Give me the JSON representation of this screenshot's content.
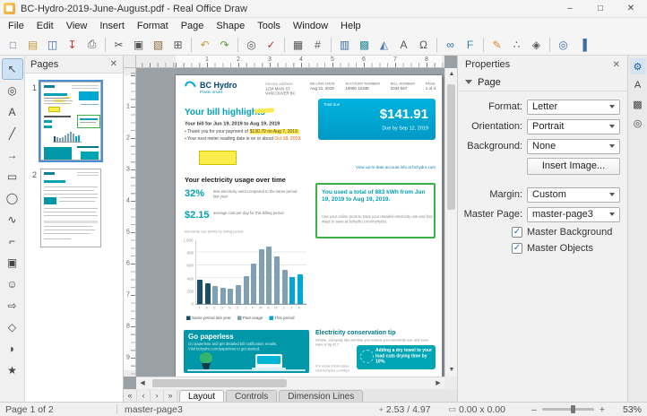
{
  "window": {
    "title": "BC-Hydro-2019-June-August.pdf - Real Office Draw",
    "minimize": "–",
    "maximize": "□",
    "close": "✕"
  },
  "menubar": {
    "items": [
      "File",
      "Edit",
      "View",
      "Insert",
      "Format",
      "Page",
      "Shape",
      "Tools",
      "Window",
      "Help"
    ]
  },
  "toolbar": {
    "items": [
      {
        "name": "new-icon",
        "glyph": "□",
        "color": "#5b7b9c"
      },
      {
        "name": "open-icon",
        "glyph": "▤",
        "color": "#c7973a"
      },
      {
        "name": "save-icon",
        "glyph": "◫",
        "color": "#3a6ea5"
      },
      {
        "name": "export-pdf-icon",
        "glyph": "↧",
        "color": "#c0392b"
      },
      {
        "name": "print-icon",
        "glyph": "⎙",
        "color": "#555555"
      },
      {
        "sep": true
      },
      {
        "name": "cut-icon",
        "glyph": "✂",
        "color": "#555555"
      },
      {
        "name": "copy-icon",
        "glyph": "▣",
        "color": "#555555"
      },
      {
        "name": "paste-icon",
        "glyph": "▧",
        "color": "#8a6d3b"
      },
      {
        "name": "clone-formatting-icon",
        "glyph": "⊞",
        "color": "#555555"
      },
      {
        "sep": true
      },
      {
        "name": "undo-icon",
        "glyph": "↶",
        "color": "#c7a23a"
      },
      {
        "name": "redo-icon",
        "glyph": "↷",
        "color": "#5a9a3a"
      },
      {
        "sep": true
      },
      {
        "name": "find-replace-icon",
        "glyph": "◎",
        "color": "#555555"
      },
      {
        "name": "spelling-icon",
        "glyph": "✓",
        "color": "#c0392b"
      },
      {
        "sep": true
      },
      {
        "name": "display-grid-icon",
        "glyph": "▦",
        "color": "#555555"
      },
      {
        "name": "helplines-icon",
        "glyph": "#",
        "color": "#555555"
      },
      {
        "sep": true
      },
      {
        "name": "insert-table-icon",
        "glyph": "▥",
        "color": "#3a6ea5"
      },
      {
        "name": "insert-image-icon",
        "glyph": "▩",
        "color": "#2e8b9a"
      },
      {
        "name": "insert-chart-icon",
        "glyph": "◭",
        "color": "#4a7fb5"
      },
      {
        "name": "insert-text-box-icon",
        "glyph": "A",
        "color": "#555555"
      },
      {
        "name": "special-character-icon",
        "glyph": "Ω",
        "color": "#555555"
      },
      {
        "sep": true
      },
      {
        "name": "hyperlink-icon",
        "glyph": "∞",
        "color": "#2e6da4"
      },
      {
        "name": "fontwork-icon",
        "glyph": "F",
        "color": "#2e86ab"
      },
      {
        "sep": true
      },
      {
        "name": "show-draw-functions-icon",
        "glyph": "✎",
        "color": "#e08a2e"
      },
      {
        "name": "points-icon",
        "glyph": "∴",
        "color": "#555555"
      },
      {
        "name": "glue-points-icon",
        "glyph": "◈",
        "color": "#555555"
      },
      {
        "sep": true
      },
      {
        "name": "zoom-icon",
        "glyph": "◎",
        "color": "#3a6ea5"
      },
      {
        "name": "sidebar-toggle-icon",
        "glyph": "▐",
        "color": "#3a6ea5"
      }
    ]
  },
  "tools": {
    "items": [
      {
        "name": "select-tool",
        "glyph": "↖",
        "active": true
      },
      {
        "name": "zoom-tool",
        "glyph": "◎"
      },
      {
        "name": "insert-text-box-tool",
        "glyph": "A"
      },
      {
        "name": "insert-line-tool",
        "glyph": "╱"
      },
      {
        "name": "lines-and-arrows-tool",
        "glyph": "→"
      },
      {
        "name": "rectangle-tool",
        "glyph": "▭"
      },
      {
        "name": "ellipse-tool",
        "glyph": "◯"
      },
      {
        "name": "curves-and-polygons-tool",
        "glyph": "∿"
      },
      {
        "name": "connectors-tool",
        "glyph": "⌐"
      },
      {
        "name": "basic-shapes-tool",
        "glyph": "▣"
      },
      {
        "name": "symbol-shapes-tool",
        "glyph": "☺"
      },
      {
        "name": "block-arrows-tool",
        "glyph": "⇨"
      },
      {
        "name": "flowchart-tool",
        "glyph": "◇"
      },
      {
        "name": "callout-shapes-tool",
        "glyph": "◗"
      },
      {
        "name": "stars-and-banners-tool",
        "glyph": "★"
      }
    ]
  },
  "pages_panel": {
    "title": "Pages",
    "close_glyph": "✕",
    "page1_number": "1",
    "page2_number": "2"
  },
  "rulers": {
    "h_numbers": [
      "1",
      "2",
      "3",
      "4",
      "5",
      "6",
      "7",
      "8"
    ],
    "v_numbers": [
      "1",
      "2",
      "3",
      "4",
      "5",
      "6",
      "7",
      "8",
      "9"
    ]
  },
  "scrollbars": {
    "up": "▲",
    "down": "▼",
    "left": "◀",
    "right": "▶"
  },
  "document": {
    "brand": {
      "name": "BC Hydro",
      "tagline": "Power smart"
    },
    "header_info": {
      "address_label": "Service address:",
      "address_line1": "1234 MAIN ST",
      "address_line2": "VANCOUVER BC",
      "cols": [
        {
          "label": "BILLING DATE",
          "value": "Aug 21, 2019"
        },
        {
          "label": "ACCOUNT NUMBER",
          "value": "10000 12345"
        },
        {
          "label": "BILL NUMBER",
          "value": "1034 567"
        },
        {
          "label": "PAGE",
          "value": "1 of 4"
        }
      ]
    },
    "highlights": {
      "title": "Your bill highlights",
      "period_line": "Your bill for Jun 19, 2019 to Aug 19, 2019",
      "bullet1_pre": "• Thank you for your payment of ",
      "bullet1_highlight": "$130.79 on Aug 7, 2019.",
      "bullet2_pre": "• Your next meter reading date is on or about ",
      "bullet2_emphasis": "Oct 18, 2019."
    },
    "total_box": {
      "label": "Total due",
      "amount": "$141.91",
      "due": "Due by Sep 12, 2019"
    },
    "account_link": "View up-to-date account info at bchydro.com",
    "usage": {
      "title": "Your electricity usage over time",
      "stat1_value": "32%",
      "stat1_caption": "less electricity used compared to the same period last year",
      "stat2_value": "$2.15",
      "stat2_caption": "average cost per day for this billing period",
      "note": "Electricity use (kWh) by billing period",
      "summary_title": "You used a total of 883 kWh from Jun 19, 2019 to Aug 19, 2019.",
      "summary_body": "Use your online tools to track your detailed electricity use and find ways to save at bchydro.com/myhydro."
    },
    "paperless": {
      "title": "Go paperless",
      "body1": "Go paperless and get detailed bill notification emails.",
      "body2": "Visit bchydro.com/paperless to get started."
    },
    "tip": {
      "title": "Electricity conservation tip",
      "intro": "Simple, everyday tips will help you reduce your electricity use and save. Here is tip #17:",
      "highlight": "Adding a dry towel to your load cuts drying time by 10%.",
      "footer": "For more information, visit bchydro.com/tips"
    }
  },
  "chart_data": {
    "type": "bar",
    "title": "Your electricity usage over time",
    "categories": [
      "J",
      "A",
      "S",
      "O",
      "N",
      "D",
      "J",
      "F",
      "M",
      "A",
      "M",
      "J",
      "J",
      "A"
    ],
    "values": [
      380,
      330,
      280,
      250,
      240,
      290,
      430,
      640,
      860,
      900,
      740,
      540,
      420,
      463
    ],
    "groups": [
      "last_year",
      "last_year",
      "past",
      "past",
      "past",
      "past",
      "past",
      "past",
      "past",
      "past",
      "past",
      "past",
      "current",
      "current"
    ],
    "palette": {
      "last_year": "#1b4f68",
      "past": "#7fa0b4",
      "current": "#00a6d6"
    },
    "ylabel": "kWh",
    "xlabel": "",
    "ylim": [
      0,
      1000
    ],
    "yticks": [
      "1,000",
      "800",
      "600",
      "400",
      "200",
      "0"
    ],
    "grid": true,
    "legend_position": "bottom",
    "legend": [
      {
        "label": "Same period last year",
        "key": "last_year"
      },
      {
        "label": "Past usage",
        "key": "past"
      },
      {
        "label": "This period",
        "key": "current"
      }
    ]
  },
  "properties": {
    "title": "Properties",
    "close_glyph": "✕",
    "section": "Page",
    "format_label": "Format:",
    "format_value": "Letter",
    "orientation_label": "Orientation:",
    "orientation_value": "Portrait",
    "background_label": "Background:",
    "background_value": "None",
    "insert_image_label": "Insert Image...",
    "margin_label": "Margin:",
    "margin_value": "Custom",
    "master_label": "Master Page:",
    "master_value": "master-page3",
    "check_glyph": "✓",
    "checkbox1": "Master Background",
    "checkbox2": "Master Objects"
  },
  "sidebar_tabs": {
    "items": [
      {
        "name": "properties-tab-icon",
        "glyph": "⚙",
        "active": true
      },
      {
        "name": "styles-tab-icon",
        "glyph": "A"
      },
      {
        "name": "gallery-tab-icon",
        "glyph": "▩"
      },
      {
        "name": "navigator-tab-icon",
        "glyph": "◎"
      }
    ]
  },
  "tabbar": {
    "nav": [
      {
        "name": "first-page-button",
        "glyph": "«"
      },
      {
        "name": "previous-page-button",
        "glyph": "‹"
      },
      {
        "name": "next-page-button",
        "glyph": "›"
      },
      {
        "name": "last-page-button",
        "glyph": "»"
      }
    ],
    "tabs": [
      {
        "label": "Layout",
        "active": true
      },
      {
        "label": "Controls",
        "active": false
      },
      {
        "label": "Dimension Lines",
        "active": false
      }
    ]
  },
  "statusbar": {
    "page_info": "Page 1 of 2",
    "master": "master-page3",
    "position_icon": "+",
    "position": "2.53 / 4.97",
    "size_icon": "▭",
    "size": "0.00 x 0.00",
    "zoom_minus": "–",
    "zoom_plus": "+",
    "zoom": "53%"
  }
}
